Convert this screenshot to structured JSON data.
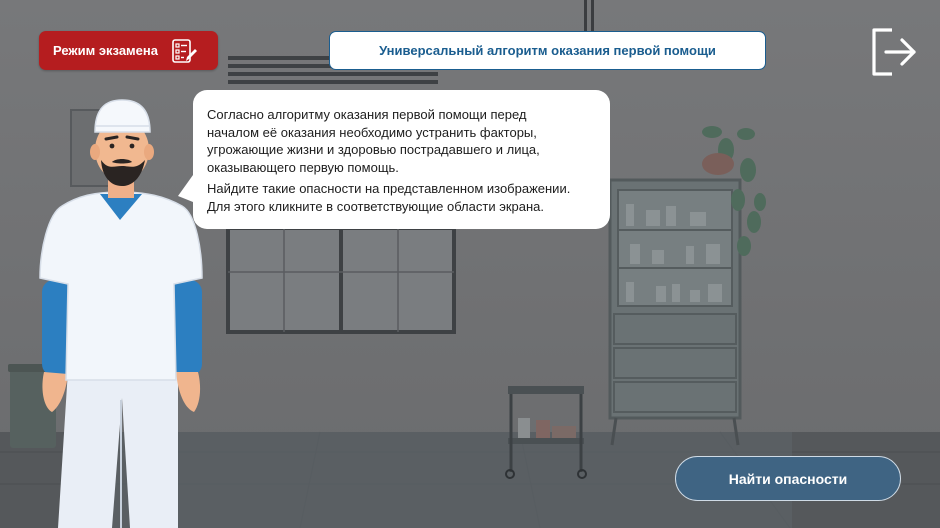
{
  "header": {
    "mode_badge": {
      "label": "Режим экзамена",
      "icon": "exam-checklist-icon",
      "color": "#b51d1f"
    },
    "title": "Универсальный алгоритм оказания первой помощи",
    "exit_icon": "exit-icon"
  },
  "dialog": {
    "paragraph_1_lines": [
      "Согласно алгоритму оказания первой помощи перед",
      "началом её оказания необходимо устранить факторы,",
      "угрожающие жизни и здоровью пострадавшего и лица,",
      "оказывающего первую помощь."
    ],
    "paragraph_2_lines": [
      "Найдите такие опасности на представленном изображении.",
      "Для этого кликните в соответствующие области экрана."
    ]
  },
  "actions": {
    "find_hazards_label": "Найти опасности"
  },
  "colors": {
    "accent": "#1a5d8f",
    "button": "#3f6483",
    "exam_red": "#b51d1f"
  }
}
